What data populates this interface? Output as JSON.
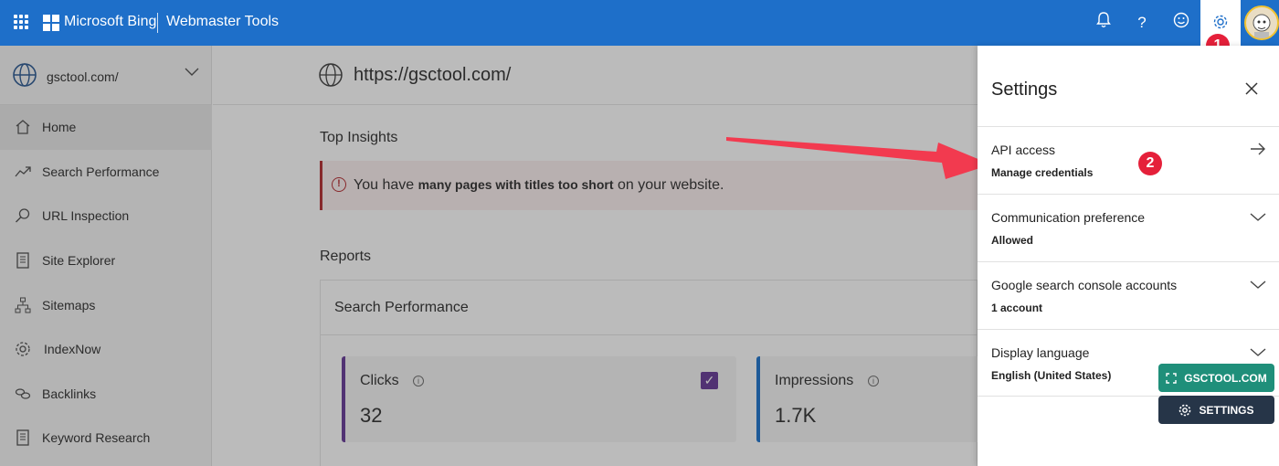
{
  "header": {
    "brand": "Microsoft Bing",
    "product": "Webmaster Tools",
    "badge_settings": "1"
  },
  "sidebar": {
    "site": "gsctool.com/",
    "items": [
      {
        "label": "Home",
        "icon": "home-icon",
        "active": true
      },
      {
        "label": "Search Performance",
        "icon": "trend-icon"
      },
      {
        "label": "URL Inspection",
        "icon": "search-icon"
      },
      {
        "label": "Site Explorer",
        "icon": "document-icon"
      },
      {
        "label": "Sitemaps",
        "icon": "sitemap-icon"
      },
      {
        "label": "IndexNow",
        "icon": "gear-icon"
      },
      {
        "label": "Backlinks",
        "icon": "link-icon"
      },
      {
        "label": "Keyword Research",
        "icon": "document-icon"
      }
    ]
  },
  "main": {
    "url": "https://gsctool.com/",
    "insights_title": "Top Insights",
    "insight": {
      "prefix": "You have ",
      "bold": "many pages with titles too short",
      "suffix": " on your website."
    },
    "reports_title": "Reports",
    "report": {
      "title": "Search Performance",
      "metrics": [
        {
          "name": "Clicks",
          "value": "32",
          "checked": true
        },
        {
          "name": "Impressions",
          "value": "1.7K"
        }
      ]
    }
  },
  "settings": {
    "title": "Settings",
    "rows": [
      {
        "title": "API access",
        "sub": "Manage credentials"
      },
      {
        "title": "Communication preference",
        "sub": "Allowed"
      },
      {
        "title": "Google search console accounts",
        "sub": "1 account"
      },
      {
        "title": "Display language",
        "sub": "English (United States)"
      }
    ],
    "badge_api": "2"
  },
  "overlay": {
    "gsctool_label": "GSCTOOL.COM",
    "settings_label": "SETTINGS"
  },
  "colors": {
    "header_bg": "#1e6fc9",
    "insight_accent": "#b01e23",
    "clicks_accent": "#5c2d91",
    "impressions_accent": "#0f6ac9",
    "badge_red": "#e5203a"
  }
}
